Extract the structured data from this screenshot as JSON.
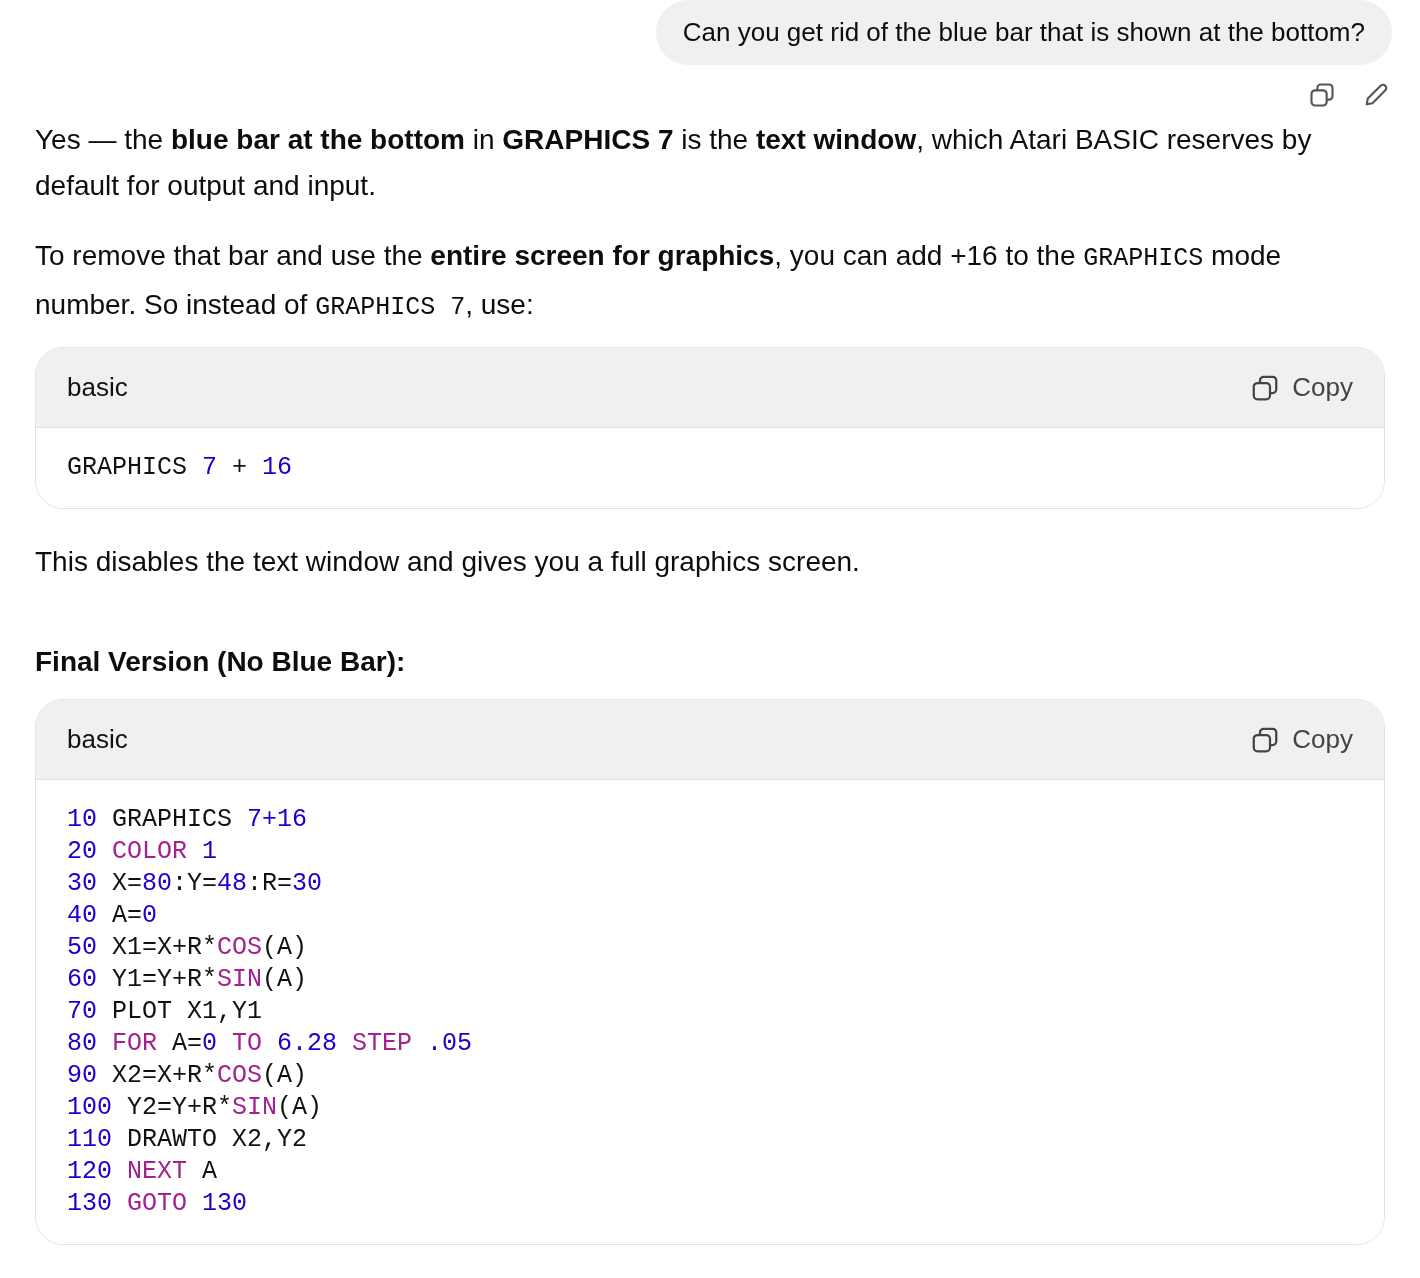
{
  "user_message": {
    "text": "Can you get rid of the blue bar that is shown at the bottom?"
  },
  "response": [
    {
      "kind": "paragraph",
      "parts": [
        {
          "kind": "text",
          "text": "Yes — the **blue bar at the bottom** in **GRAPHICS 7** is the **text window**, which Atari BASIC reserves by default for output and input."
        }
      ]
    },
    {
      "kind": "paragraph",
      "parts": [
        {
          "kind": "text",
          "text": "To remove that bar and use the **entire screen for graphics**, you can add +16 to the "
        },
        {
          "kind": "code",
          "text": "GRAPHICS"
        },
        {
          "kind": "text",
          "text": " mode number. So instead of "
        },
        {
          "kind": "code",
          "text": "GRAPHICS 7"
        },
        {
          "kind": "text",
          "text": ", use:"
        }
      ]
    },
    {
      "kind": "code",
      "language": "basic",
      "copy_label": "Copy",
      "lines": [
        [
          {
            "kind": "plain",
            "text": "GRAPHICS "
          },
          {
            "kind": "num",
            "text": "7"
          },
          {
            "kind": "plain",
            "text": " + "
          },
          {
            "kind": "num",
            "text": "16"
          }
        ]
      ]
    },
    {
      "kind": "paragraph",
      "parts": [
        {
          "kind": "text",
          "text": "This disables the text window and gives you a full graphics screen."
        }
      ]
    },
    {
      "kind": "heading",
      "text": "Final Version (No Blue Bar):"
    },
    {
      "kind": "code",
      "language": "basic",
      "copy_label": "Copy",
      "lines": [
        [
          {
            "kind": "num",
            "text": "10"
          },
          {
            "kind": "plain",
            "text": " GRAPHICS "
          },
          {
            "kind": "num",
            "text": "7+16"
          }
        ],
        [
          {
            "kind": "num",
            "text": "20"
          },
          {
            "kind": "kw",
            "text": " COLOR"
          },
          {
            "kind": "num",
            "text": " 1"
          }
        ],
        [
          {
            "kind": "num",
            "text": "30"
          },
          {
            "kind": "plain",
            "text": " X="
          },
          {
            "kind": "num",
            "text": "80"
          },
          {
            "kind": "plain",
            "text": ":Y="
          },
          {
            "kind": "num",
            "text": "48"
          },
          {
            "kind": "plain",
            "text": ":R="
          },
          {
            "kind": "num",
            "text": "30"
          }
        ],
        [
          {
            "kind": "num",
            "text": "40"
          },
          {
            "kind": "plain",
            "text": " A="
          },
          {
            "kind": "num",
            "text": "0"
          }
        ],
        [
          {
            "kind": "num",
            "text": "50"
          },
          {
            "kind": "plain",
            "text": " X1=X+R*"
          },
          {
            "kind": "kw",
            "text": "COS"
          },
          {
            "kind": "plain",
            "text": "(A)"
          }
        ],
        [
          {
            "kind": "num",
            "text": "60"
          },
          {
            "kind": "plain",
            "text": " Y1=Y+R*"
          },
          {
            "kind": "kw",
            "text": "SIN"
          },
          {
            "kind": "plain",
            "text": "(A)"
          }
        ],
        [
          {
            "kind": "num",
            "text": "70"
          },
          {
            "kind": "plain",
            "text": " PLOT X1,Y1"
          }
        ],
        [
          {
            "kind": "num",
            "text": "80"
          },
          {
            "kind": "kw",
            "text": " FOR"
          },
          {
            "kind": "plain",
            "text": " A="
          },
          {
            "kind": "num",
            "text": "0"
          },
          {
            "kind": "kw",
            "text": " TO"
          },
          {
            "kind": "num",
            "text": " 6.28"
          },
          {
            "kind": "kw",
            "text": " STEP"
          },
          {
            "kind": "num",
            "text": " .05"
          }
        ],
        [
          {
            "kind": "num",
            "text": "90"
          },
          {
            "kind": "plain",
            "text": " X2=X+R*"
          },
          {
            "kind": "kw",
            "text": "COS"
          },
          {
            "kind": "plain",
            "text": "(A)"
          }
        ],
        [
          {
            "kind": "num",
            "text": "100"
          },
          {
            "kind": "plain",
            "text": " Y2=Y+R*"
          },
          {
            "kind": "kw",
            "text": "SIN"
          },
          {
            "kind": "plain",
            "text": "(A)"
          }
        ],
        [
          {
            "kind": "num",
            "text": "110"
          },
          {
            "kind": "plain",
            "text": " DRAWTO X2,Y2"
          }
        ],
        [
          {
            "kind": "num",
            "text": "120"
          },
          {
            "kind": "kw",
            "text": " NEXT"
          },
          {
            "kind": "plain",
            "text": " A"
          }
        ],
        [
          {
            "kind": "num",
            "text": "130"
          },
          {
            "kind": "kw",
            "text": " GOTO"
          },
          {
            "kind": "num",
            "text": " 130"
          }
        ]
      ]
    }
  ]
}
